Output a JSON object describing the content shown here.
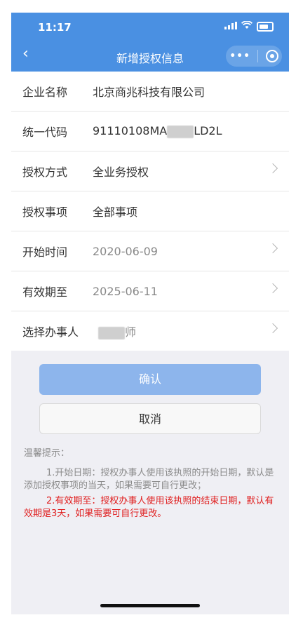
{
  "status": {
    "time": "11:17",
    "signal": ".ıl",
    "wifi": "☵"
  },
  "nav": {
    "back": "‹",
    "title": "新增授权信息",
    "more": "•••"
  },
  "form": {
    "rows": [
      {
        "label": "企业名称",
        "value": "北京商兆科技有限公司"
      },
      {
        "label": "统一代码",
        "value_prefix": "91110108MA",
        "value_suffix": "LD2L"
      },
      {
        "label": "授权方式",
        "value": "全业务授权"
      },
      {
        "label": "授权事项",
        "value": "全部事项"
      },
      {
        "label": "开始时间",
        "value": "2020-06-09"
      },
      {
        "label": "有效期至",
        "value": "2025-06-11"
      },
      {
        "label": "选择办事人",
        "value_suffix": "师"
      }
    ]
  },
  "buttons": {
    "confirm": "确认",
    "cancel": "取消"
  },
  "tips": {
    "title": "温馨提示：",
    "tip1": "1.开始日期：授权办事人使用该执照的开始日期，默认是添加授权事项的当天，如果需要可自行更改；",
    "tip2": "2.有效期至：授权办事人使用该执照的结束日期，默认有效期是3天，如果需要可自行更改。"
  },
  "colors": {
    "primary": "#4a90e2",
    "confirm_bg": "#8db5ec",
    "warning": "#e02020"
  }
}
